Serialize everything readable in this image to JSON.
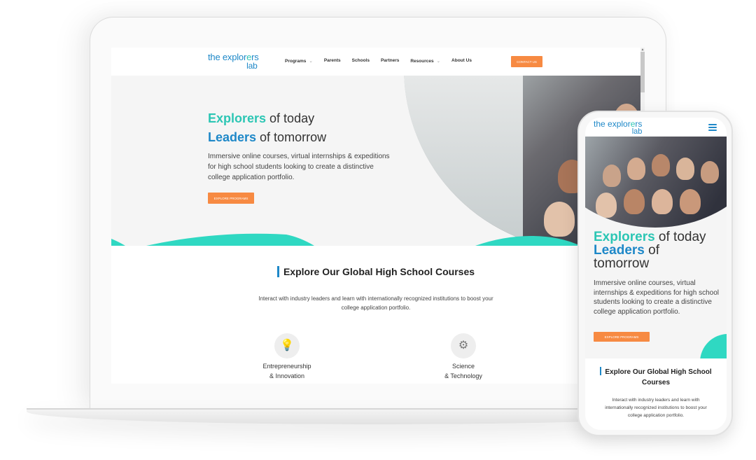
{
  "brand": {
    "logo_part1": "the explor",
    "logo_part2": "e",
    "logo_part3": "rs",
    "logo_line2": "lab",
    "colors": {
      "teal": "#2cc6b4",
      "blue": "#1e88c8",
      "orange": "#f78a42",
      "wave": "#2fd8c2"
    }
  },
  "desktop": {
    "nav": {
      "items": [
        {
          "label": "Programs",
          "has_dropdown": true
        },
        {
          "label": "Parents",
          "has_dropdown": false
        },
        {
          "label": "Schools",
          "has_dropdown": false
        },
        {
          "label": "Partners",
          "has_dropdown": false
        },
        {
          "label": "Resources",
          "has_dropdown": true
        },
        {
          "label": "About Us",
          "has_dropdown": false
        }
      ],
      "chevron": "⌄",
      "contact_button": "CONTACT US"
    },
    "hero": {
      "line1_accent": "Explorers",
      "line1_rest": " of today",
      "line2_accent": "Leaders",
      "line2_rest": " of tomorrow",
      "description": "Immersive online courses, virtual internships & expeditions for high school students looking to create a distinctive college application portfolio.",
      "cta": "EXPLORE PROGRAMS",
      "image_alt": "group-of-students-photo"
    },
    "courses": {
      "title": "Explore Our Global High School Courses",
      "description": "Interact with industry leaders and learn with internationally recognized institutions to boost your college application portfolio.",
      "items": [
        {
          "line1": "Entrepreneurship",
          "line2": "& Innovation",
          "icon": "lightbulb-person-icon",
          "glyph": "💡"
        },
        {
          "line1": "Science",
          "line2": "& Technology",
          "icon": "lightbulb-gear-icon",
          "glyph": "⚙"
        }
      ]
    }
  },
  "mobile": {
    "menu_icon": "hamburger-menu-icon",
    "hero": {
      "line1_accent": "Explorers",
      "line1_rest": " of today",
      "line2_accent": "Leaders",
      "line2_rest": " of",
      "line3": "tomorrow",
      "description": "Immersive online courses, virtual internships & expeditions for high school students looking to create a distinctive college application portfolio.",
      "cta": "EXPLORE PROGRAMS"
    },
    "courses": {
      "title": "Explore Our Global High School Courses",
      "description": "Interact with industry leaders and learn with internationally recognized institutions to boost your college application portfolio."
    }
  }
}
